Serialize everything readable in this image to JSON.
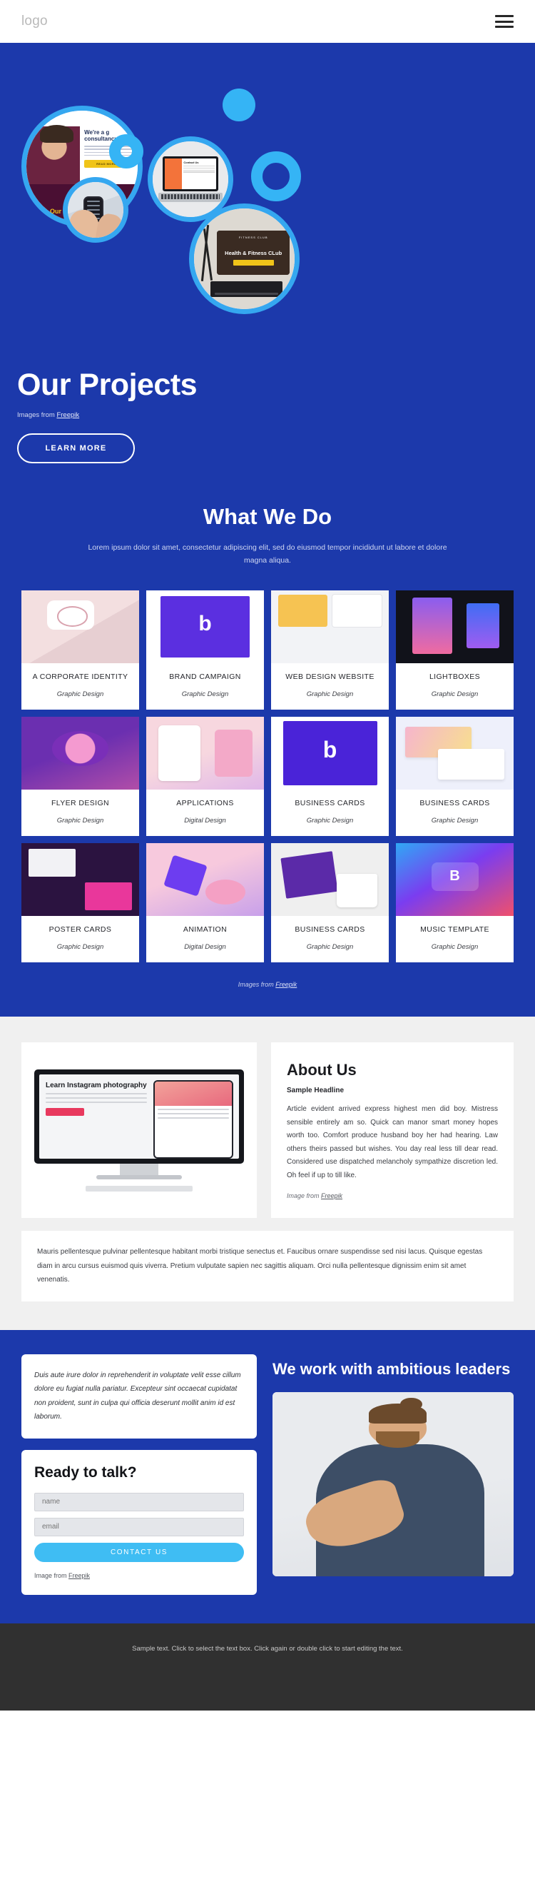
{
  "header": {
    "logo": "logo",
    "menu_icon": "hamburger-menu-icon"
  },
  "hero": {
    "title": "Our Projects",
    "credit_prefix": "Images from ",
    "credit_link": "Freepik",
    "button": "LEARN MORE",
    "bubbles": [
      {
        "name": "consultancy-website-bubble",
        "headline_line1": "We're a g",
        "headline_line2": "consultancy",
        "button": "READ MORE",
        "band_text": "Us & Our Work"
      },
      {
        "name": "mobile-app-bubble"
      },
      {
        "name": "laptop-contact-bubble",
        "screen_title": "Contact Us"
      },
      {
        "name": "fitness-tablet-bubble",
        "screen_logo": "FITNESS CLUB",
        "screen_title": "Health & Fitness CLub"
      }
    ]
  },
  "work": {
    "title": "What We Do",
    "subtitle": "Lorem ipsum dolor sit amet, consectetur adipiscing elit, sed do eiusmod tempor incididunt ut labore et dolore magna aliqua.",
    "credit_prefix": "Images from ",
    "credit_link": "Freepik",
    "cards": [
      {
        "title": "A CORPORATE IDENTITY",
        "category": "Graphic Design",
        "thumb": "t1"
      },
      {
        "title": "BRAND CAMPAIGN",
        "category": "Graphic Design",
        "thumb": "t2"
      },
      {
        "title": "WEB DESIGN WEBSITE",
        "category": "Graphic Design",
        "thumb": "t3"
      },
      {
        "title": "LIGHTBOXES",
        "category": "Graphic Design",
        "thumb": "t4"
      },
      {
        "title": "FLYER DESIGN",
        "category": "Graphic Design",
        "thumb": "t5"
      },
      {
        "title": "APPLICATIONS",
        "category": "Digital Design",
        "thumb": "t6"
      },
      {
        "title": "BUSINESS CARDS",
        "category": "Graphic Design",
        "thumb": "t7"
      },
      {
        "title": "BUSINESS CARDS",
        "category": "Graphic Design",
        "thumb": "t8"
      },
      {
        "title": "POSTER CARDS",
        "category": "Graphic Design",
        "thumb": "t9"
      },
      {
        "title": "ANIMATION",
        "category": "Digital Design",
        "thumb": "t10"
      },
      {
        "title": "BUSINESS CARDS",
        "category": "Graphic Design",
        "thumb": "t11"
      },
      {
        "title": "MUSIC TEMPLATE",
        "category": "Graphic Design",
        "thumb": "t12"
      }
    ]
  },
  "about": {
    "screen_headline": "Learn Instagram photography",
    "title": "About Us",
    "headline": "Sample Headline",
    "body": "Article evident arrived express highest men did boy. Mistress sensible entirely am so. Quick can manor smart money hopes worth too. Comfort produce husband boy her had hearing. Law others theirs passed but wishes. You day real less till dear read. Considered use dispatched melancholy sympathize discretion led. Oh feel if up to till like.",
    "credit_prefix": "Image from ",
    "credit_link": "Freepik",
    "note": "Mauris pellentesque pulvinar pellentesque habitant morbi tristique senectus et. Faucibus ornare suspendisse sed nisi lacus. Quisque egestas diam in arcu cursus euismod quis viverra. Pretium vulputate sapien nec sagittis aliquam. Orci nulla pellentesque dignissim enim sit amet venenatis."
  },
  "cta": {
    "quote": "Duis aute irure dolor in reprehenderit in voluptate velit esse cillum dolore eu fugiat nulla pariatur. Excepteur sint occaecat cupidatat non proident, sunt in culpa qui officia deserunt mollit anim id est laborum.",
    "form_title": "Ready to talk?",
    "name_placeholder": "name",
    "email_placeholder": "email",
    "name_value": "",
    "email_value": "",
    "submit": "CONTACT US",
    "credit_prefix": "Image from ",
    "credit_link": "Freepik",
    "heading": "We work with ambitious leaders",
    "photo": "smiling-man-portrait"
  },
  "footer": {
    "text": "Sample text. Click to select the text box. Click again or double click to start editing the text."
  },
  "colors": {
    "brand_blue": "#1c39ab",
    "accent_cyan": "#35b4f5",
    "button_cyan": "#3fbdf3",
    "footer_dark": "#303030",
    "page_grey": "#f0f0f0"
  }
}
